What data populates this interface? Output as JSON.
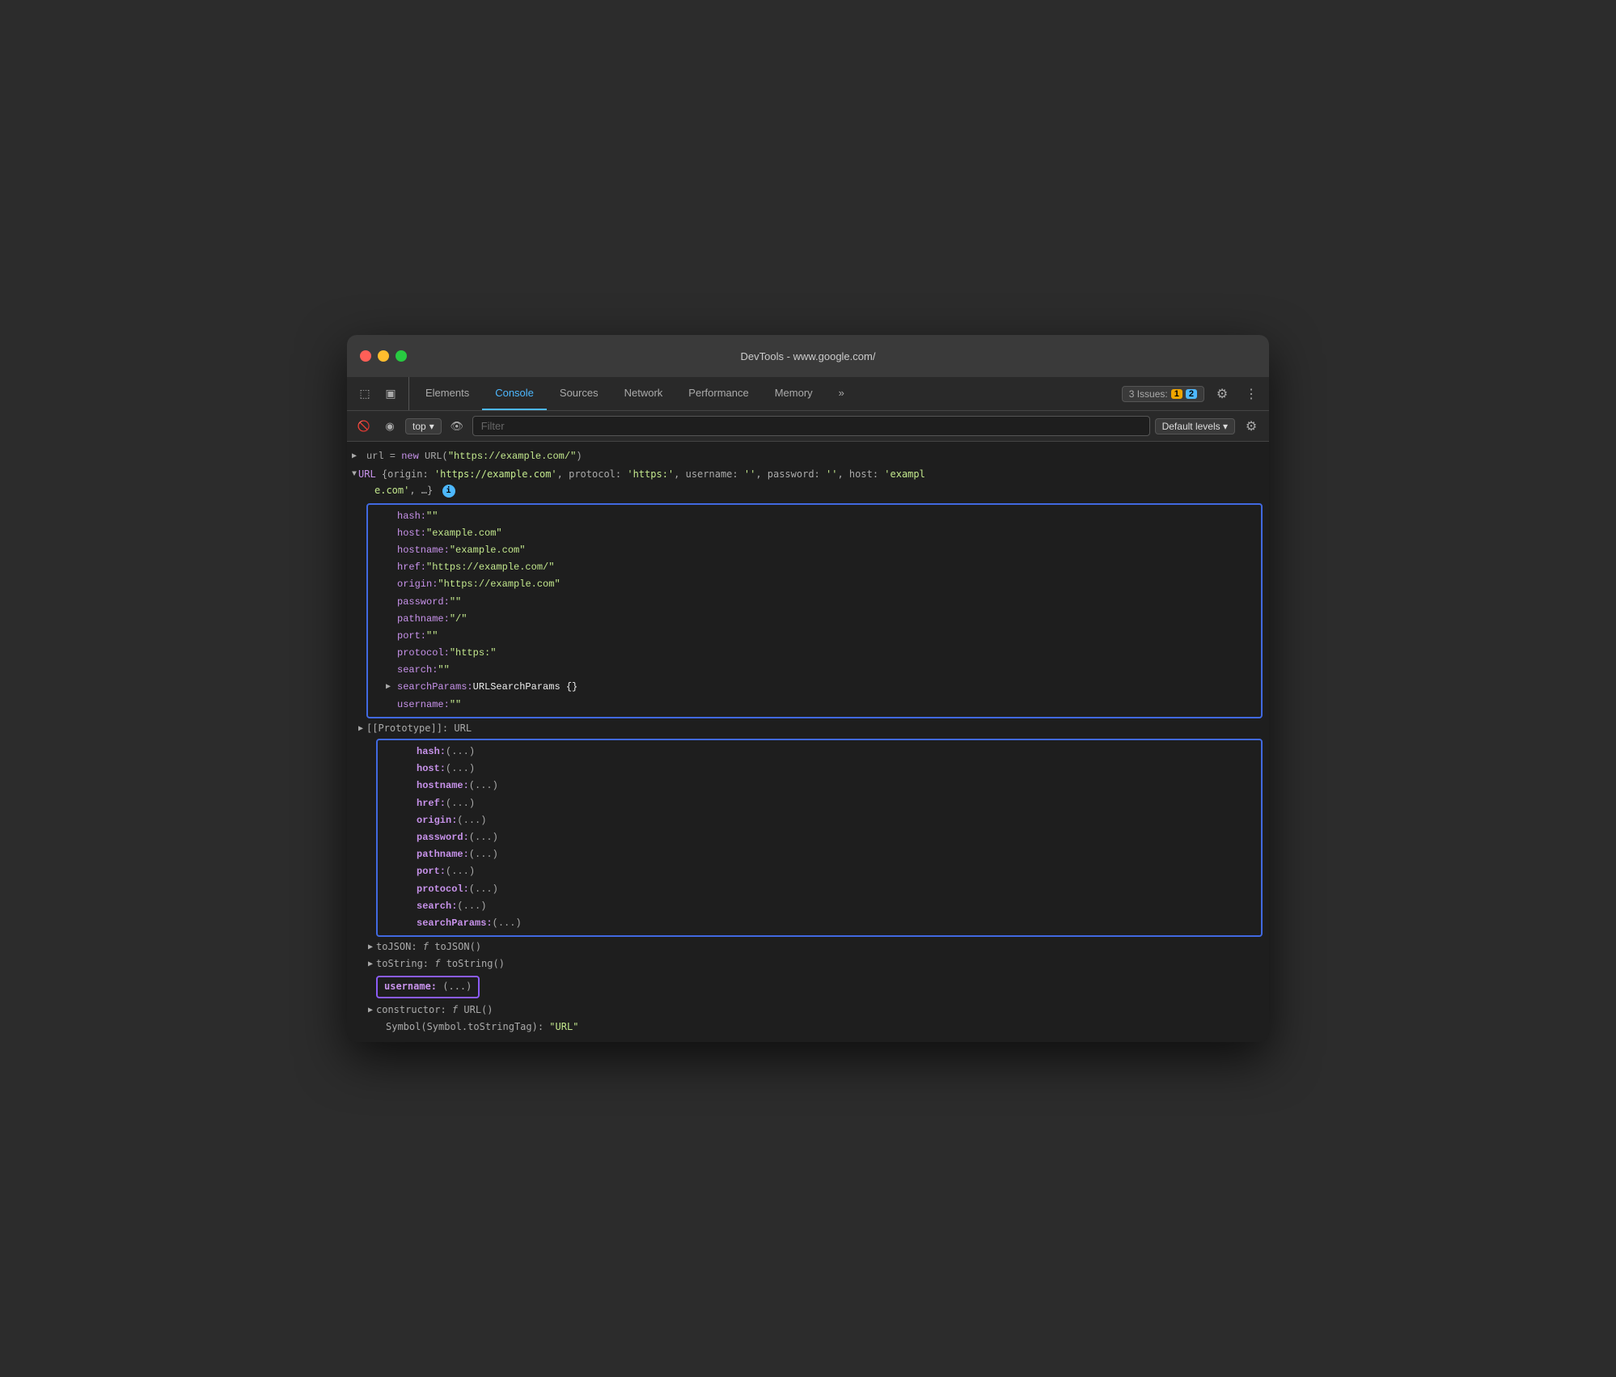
{
  "window": {
    "title": "DevTools - www.google.com/",
    "traffic_lights": [
      "close",
      "minimize",
      "maximize"
    ]
  },
  "tabs": {
    "items": [
      {
        "label": "Elements",
        "active": false
      },
      {
        "label": "Console",
        "active": true
      },
      {
        "label": "Sources",
        "active": false
      },
      {
        "label": "Network",
        "active": false
      },
      {
        "label": "Performance",
        "active": false
      },
      {
        "label": "Memory",
        "active": false
      },
      {
        "label": "»",
        "active": false
      }
    ]
  },
  "toolbar": {
    "context": "top",
    "filter_placeholder": "Filter",
    "levels_label": "Default levels ▾",
    "issues_label": "3 Issues:",
    "issues_warn": "1",
    "issues_info": "2"
  },
  "console": {
    "input_line": "url = new URL(\"https://example.com/\")",
    "url_obj_summary": "URL {origin: 'https://example.com', protocol: 'https:', username: '', password: '', host: 'example.com', …}",
    "url_obj_summary_short": "URL {origin: 'https://example.com', protocol: 'https:', username: '', password: '', host: 'exampl",
    "url_obj_summary_cont": "e.com', …}",
    "properties": [
      {
        "key": "hash:",
        "value": "\"\"",
        "type": "string"
      },
      {
        "key": "host:",
        "value": "\"example.com\"",
        "type": "string"
      },
      {
        "key": "hostname:",
        "value": "\"example.com\"",
        "type": "string"
      },
      {
        "key": "href:",
        "value": "\"https://example.com/\"",
        "type": "string"
      },
      {
        "key": "origin:",
        "value": "\"https://example.com\"",
        "type": "string"
      },
      {
        "key": "password:",
        "value": "\"\"",
        "type": "string"
      },
      {
        "key": "pathname:",
        "value": "\"/\"",
        "type": "string"
      },
      {
        "key": "port:",
        "value": "\"\"",
        "type": "string"
      },
      {
        "key": "protocol:",
        "value": "\"https:\"",
        "type": "string"
      },
      {
        "key": "search:",
        "value": "\"\"",
        "type": "string"
      },
      {
        "key": "searchParams:",
        "value": "URLSearchParams {}",
        "type": "object"
      },
      {
        "key": "username:",
        "value": "\"\"",
        "type": "string"
      }
    ],
    "prototype_label": "[[Prototype]]: URL",
    "prototype_props": [
      {
        "key": "hash:",
        "value": "(...)"
      },
      {
        "key": "host:",
        "value": "(...)"
      },
      {
        "key": "hostname:",
        "value": "(...)"
      },
      {
        "key": "href:",
        "value": "(...)"
      },
      {
        "key": "origin:",
        "value": "(...)"
      },
      {
        "key": "password:",
        "value": "(...)"
      },
      {
        "key": "pathname:",
        "value": "(...)"
      },
      {
        "key": "port:",
        "value": "(...)"
      },
      {
        "key": "protocol:",
        "value": "(...)"
      },
      {
        "key": "search:",
        "value": "(...)"
      },
      {
        "key": "searchParams:",
        "value": "(...)"
      }
    ],
    "tojson_line": "toJSON: f toJSON()",
    "tostring_line": "toString: f toString()",
    "username_highlighted": "username: (...)",
    "constructor_line": "constructor: f URL()",
    "symbol_line": "Symbol(Symbol.toStringTag): \"URL\""
  }
}
